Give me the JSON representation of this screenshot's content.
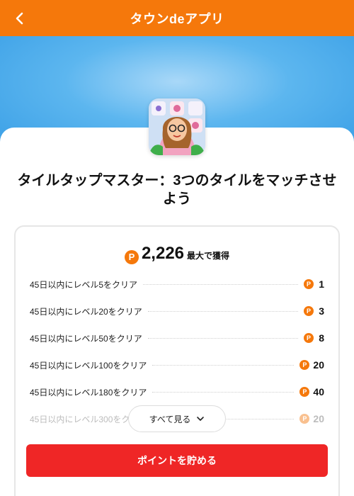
{
  "header": {
    "title": "タウンdeアプリ"
  },
  "app": {
    "title": "タイルタップマスター：3つのタイルをマッチさせよう"
  },
  "reward": {
    "total": "2,226",
    "total_suffix": "最大で獲得",
    "coin_glyph": "P",
    "tasks": [
      {
        "label": "45日以内にレベル5をクリア",
        "points": "1"
      },
      {
        "label": "45日以内にレベル20をクリア",
        "points": "3"
      },
      {
        "label": "45日以内にレベル50をクリア",
        "points": "8"
      },
      {
        "label": "45日以内にレベル100をクリア",
        "points": "20"
      },
      {
        "label": "45日以内にレベル180をクリア",
        "points": "40"
      },
      {
        "label": "45日以内にレベル300をクリア",
        "points": "20"
      }
    ]
  },
  "buttons": {
    "see_all": "すべて見る",
    "save_points": "ポイントを貯める"
  },
  "colors": {
    "header": "#f5780b",
    "coin": "#f5780b",
    "cta": "#ef2626",
    "hero": "#5cb6ef"
  }
}
